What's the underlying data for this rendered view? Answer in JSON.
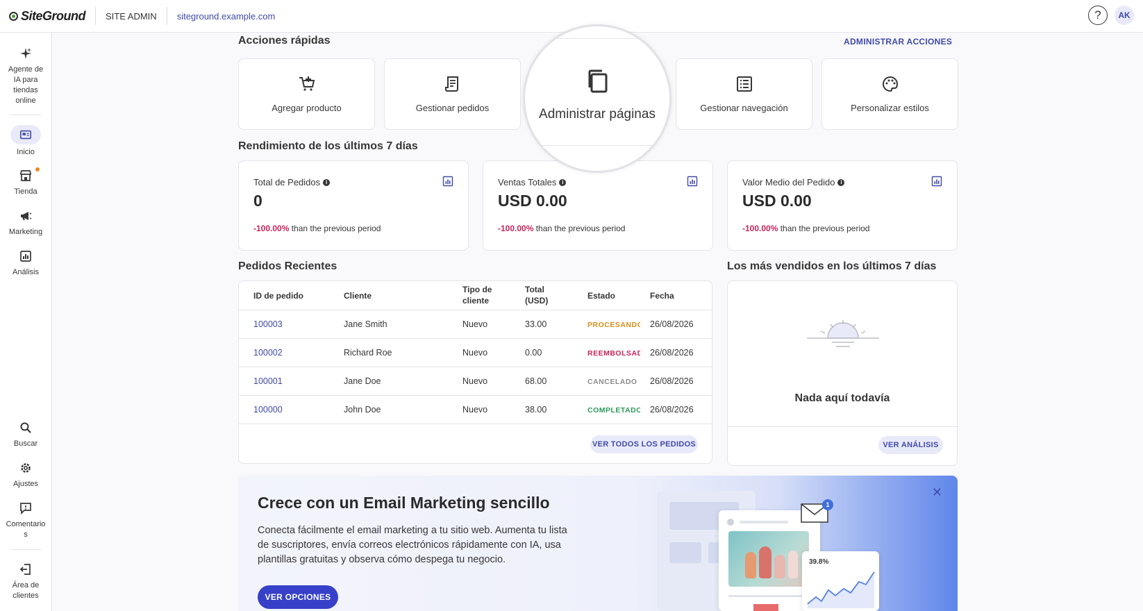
{
  "topbar": {
    "logo_text": "SiteGround",
    "site_admin": "SITE ADMIN",
    "site_url": "siteground.example.com",
    "help_label": "?",
    "avatar_initials": "AK"
  },
  "sidebar": {
    "items": [
      {
        "label": "Agente de IA para tiendas online",
        "icon": "sparkle-icon"
      },
      {
        "label": "Inicio",
        "icon": "dashboard-icon",
        "active": true
      },
      {
        "label": "Tienda",
        "icon": "store-icon",
        "badge": true
      },
      {
        "label": "Marketing",
        "icon": "megaphone-icon"
      },
      {
        "label": "Análisis",
        "icon": "chart-icon"
      },
      {
        "label": "Buscar",
        "icon": "search-icon"
      },
      {
        "label": "Ajustes",
        "icon": "gear-icon"
      },
      {
        "label": "Comentarios",
        "icon": "comment-icon"
      },
      {
        "label": "Área de clientes",
        "icon": "logout-icon"
      }
    ]
  },
  "quick_actions": {
    "title": "Acciones rápidas",
    "manage_link": "ADMINISTRAR ACCIONES",
    "items": [
      {
        "label": "Agregar producto",
        "icon": "cart-add-icon"
      },
      {
        "label": "Gestionar pedidos",
        "icon": "receipt-icon"
      },
      {
        "label": "Administrar páginas",
        "icon": "pages-icon"
      },
      {
        "label": "Gestionar navegación",
        "icon": "list-icon"
      },
      {
        "label": "Personalizar estilos",
        "icon": "palette-icon"
      }
    ]
  },
  "performance": {
    "title": "Rendimiento de los últimos 7 días",
    "metrics": [
      {
        "label": "Total de Pedidos",
        "value": "0",
        "change": "-100.00%",
        "change_suffix": "than the previous period"
      },
      {
        "label": "Ventas Totales",
        "value": "USD 0.00",
        "change": "-100.00%",
        "change_suffix": "than the previous period"
      },
      {
        "label": "Valor Medio del Pedido",
        "value": "USD 0.00",
        "change": "-100.00%",
        "change_suffix": "than the previous period"
      }
    ]
  },
  "orders": {
    "title": "Pedidos Recientes",
    "columns": [
      "ID de pedido",
      "Cliente",
      "Tipo de cliente",
      "Total (USD)",
      "Estado",
      "Fecha"
    ],
    "rows": [
      {
        "id": "100003",
        "customer": "Jane Smith",
        "type": "Nuevo",
        "total": "33.00",
        "status": "PROCESANDO",
        "status_color": "#d9901a",
        "date": "26/08/2026"
      },
      {
        "id": "100002",
        "customer": "Richard Roe",
        "type": "Nuevo",
        "total": "0.00",
        "status": "REEMBOLSADO",
        "status_color": "#c8245b",
        "date": "26/08/2026"
      },
      {
        "id": "100001",
        "customer": "Jane Doe",
        "type": "Nuevo",
        "total": "68.00",
        "status": "CANCELADO",
        "status_color": "#8a8a8a",
        "date": "26/08/2026"
      },
      {
        "id": "100000",
        "customer": "John Doe",
        "type": "Nuevo",
        "total": "38.00",
        "status": "COMPLETADO",
        "status_color": "#2b9a5a",
        "date": "26/08/2026"
      }
    ],
    "view_all": "VER TODOS LOS PEDIDOS"
  },
  "bestsellers": {
    "title": "Los más vendidos en los últimos 7 días",
    "empty_text": "Nada aquí todavía",
    "view_link": "VER ANÁLISIS"
  },
  "banner": {
    "title": "Crece con un Email Marketing sencillo",
    "text": "Conecta fácilmente el email marketing a tu sitio web. Aumenta tu lista de suscriptores, envía correos electrónicos rápidamente con IA, usa plantillas gratuitas y observa cómo despega tu negocio.",
    "button": "VER OPCIONES",
    "close": "✕",
    "illus_stat": "39.8%",
    "illus_badge": "1"
  },
  "colors": {
    "accent": "#3f4aa8",
    "primary_button": "#3640c8",
    "negative": "#c8245b"
  }
}
